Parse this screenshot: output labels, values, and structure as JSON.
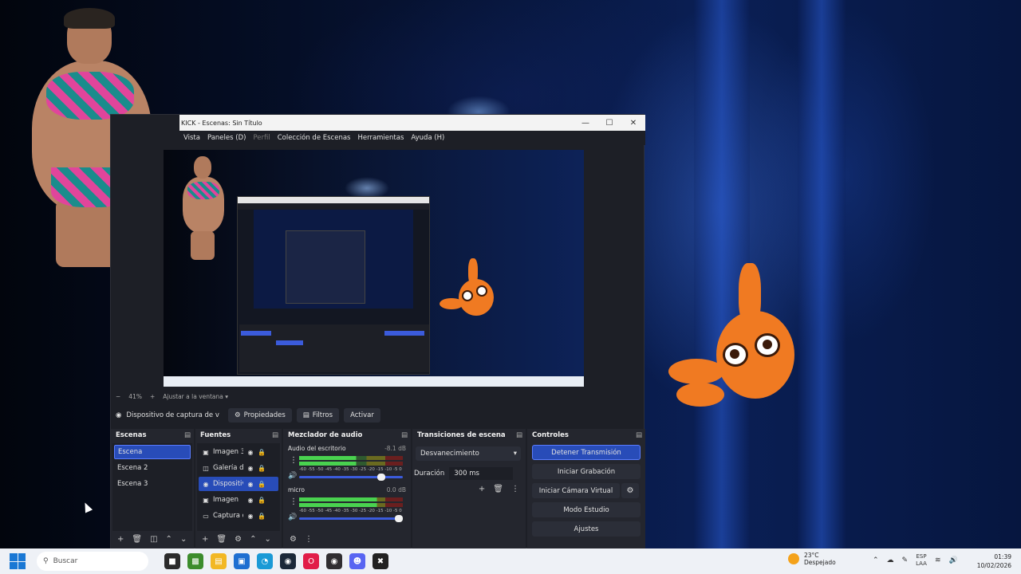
{
  "obs": {
    "title": "KICK - Escenas: Sin Título",
    "menu": {
      "vista": "Vista",
      "paneles": "Paneles (D)",
      "perfil": "Perfil",
      "coleccion": "Colección de Escenas",
      "herramientas": "Herramientas",
      "ayuda": "Ayuda (H)"
    },
    "zoom": {
      "minus": "−",
      "value": "41%",
      "plus": "+",
      "fit": "Ajustar a la ventana"
    },
    "toolbar": {
      "source_name": "Dispositivo de captura de v",
      "properties": "Propiedades",
      "filters": "Filtros",
      "activate": "Activar"
    },
    "scenes": {
      "header": "Escenas",
      "items": [
        "Escena",
        "Escena 2",
        "Escena 3"
      ],
      "active_index": 0
    },
    "sources": {
      "header": "Fuentes",
      "items": [
        {
          "name": "Imagen 3",
          "icon": "image-icon"
        },
        {
          "name": "Galería de",
          "icon": "slideshow-icon"
        },
        {
          "name": "Dispositiv",
          "icon": "camera-icon"
        },
        {
          "name": "Imagen",
          "icon": "image-icon"
        },
        {
          "name": "Captura d",
          "icon": "monitor-icon"
        }
      ],
      "active_index": 2
    },
    "mixer": {
      "header": "Mezclador de audio",
      "channels": [
        {
          "name": "Audio del escritorio",
          "db": "-8.1 dB",
          "level": 0.55,
          "volume": 0.83
        },
        {
          "name": "micro",
          "db": "0.0 dB",
          "level": 0.75,
          "volume": 1.0
        }
      ],
      "ticks": "-60 -55 -50 -45 -40 -35 -30 -25 -20 -15 -10 -5 0"
    },
    "transitions": {
      "header": "Transiciones de escena",
      "selected": "Desvanecimiento",
      "duration_label": "Duración",
      "duration_value": "300 ms"
    },
    "controls": {
      "header": "Controles",
      "stop_stream": "Detener Transmisión",
      "start_recording": "Iniciar Grabación",
      "virtual_cam": "Iniciar Cámara Virtual",
      "studio_mode": "Modo Estudio",
      "settings": "Ajustes"
    }
  },
  "taskbar": {
    "search_placeholder": "Buscar",
    "weather_temp": "23°C",
    "weather_desc": "Despejado",
    "lang_top": "ESP",
    "lang_bottom": "LAA",
    "time": "01:39",
    "date": "10/02/2026"
  },
  "colors": {
    "accent": "#284cb8",
    "dock_bg": "#24262e",
    "window_bg": "#1d1f26"
  }
}
